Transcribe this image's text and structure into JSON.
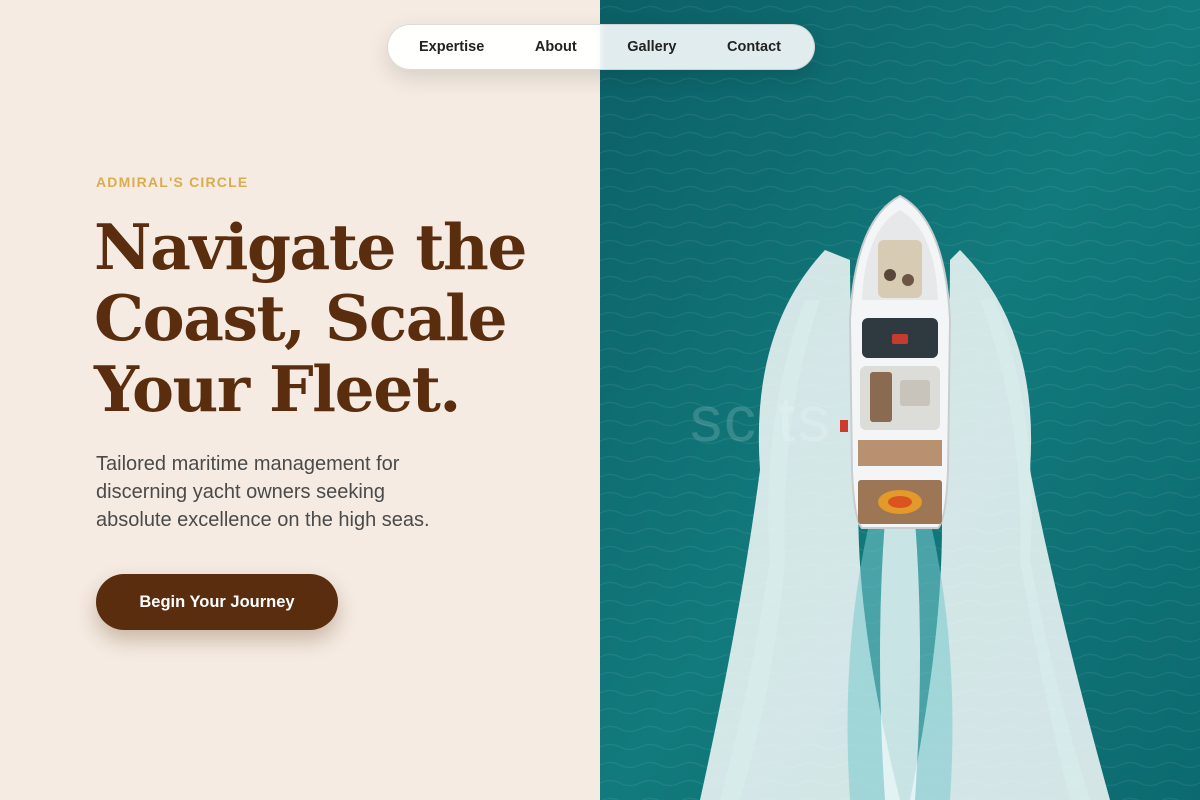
{
  "nav": {
    "items": [
      {
        "label": "Expertise"
      },
      {
        "label": "About"
      },
      {
        "label": "Gallery"
      },
      {
        "label": "Contact"
      }
    ]
  },
  "hero": {
    "eyebrow": "ADMIRAL'S CIRCLE",
    "headline_lines": [
      "Navigate the",
      "Coast, Scale",
      "Your Fleet."
    ],
    "subtext_lines": [
      "Tailored maritime management for",
      "discerning yacht owners seeking",
      "absolute excellence on the high seas."
    ],
    "cta_label": "Begin Your Journey"
  },
  "image": {
    "description_icon": "yacht-aerial-photo",
    "watermark_text": "sc     ts"
  },
  "colors": {
    "background": "#f5ebe2",
    "brand_brown": "#5a2d0f",
    "accent_gold": "#d9ad4e",
    "water_teal": "#0f6f73"
  }
}
